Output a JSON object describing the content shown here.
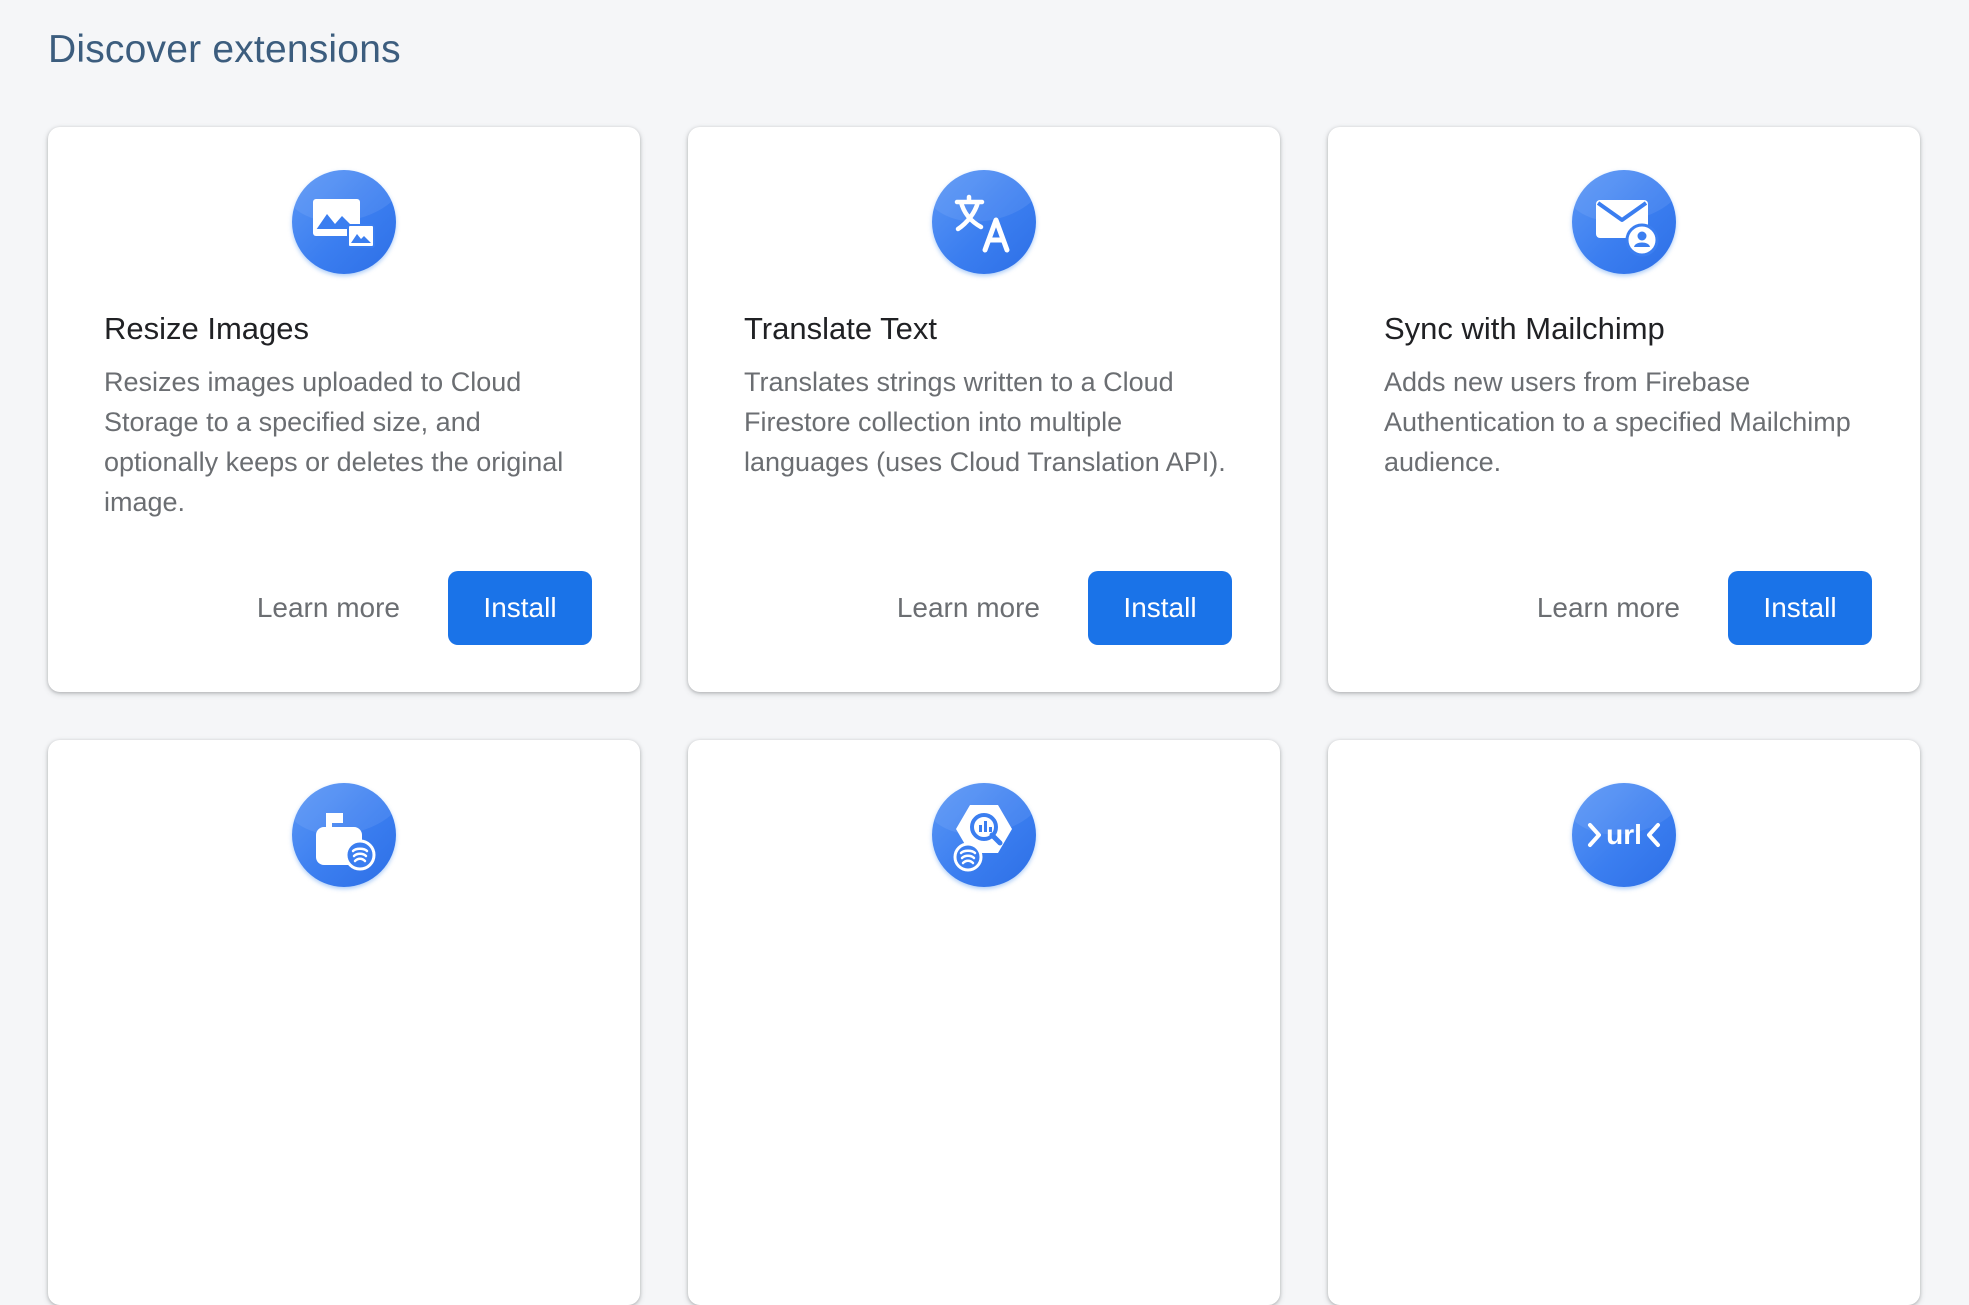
{
  "page": {
    "title": "Discover extensions"
  },
  "extensions": [
    {
      "title": "Resize Images",
      "description": "Resizes images uploaded to Cloud Storage to a specified size, and optionally keeps or deletes the original image.",
      "icon": "image-resize-icon",
      "learn_more": "Learn more",
      "install": "Install"
    },
    {
      "title": "Translate Text",
      "description": "Translates strings written to a Cloud Firestore collection into multiple languages (uses Cloud Translation API).",
      "icon": "translate-icon",
      "learn_more": "Learn more",
      "install": "Install"
    },
    {
      "title": "Sync with Mailchimp",
      "description": "Adds new users from Firebase Authentication to a specified Mailchimp audience.",
      "icon": "mail-user-icon",
      "learn_more": "Learn more",
      "install": "Install"
    },
    {
      "title": "",
      "description": "",
      "icon": "mailbox-firebase-icon",
      "learn_more": "",
      "install": ""
    },
    {
      "title": "",
      "description": "",
      "icon": "bigquery-firebase-icon",
      "learn_more": "",
      "install": ""
    },
    {
      "title": "",
      "description": "",
      "icon": "url-shortener-icon",
      "learn_more": "",
      "install": ""
    }
  ],
  "colors": {
    "accent": "#1a73e8",
    "title": "#3c5d7e",
    "background": "#f5f6f8"
  }
}
